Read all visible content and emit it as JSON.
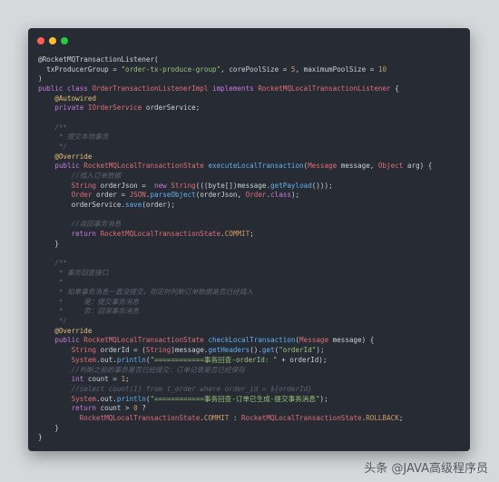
{
  "window": {
    "traffic_lights": [
      {
        "name": "close",
        "color": "#ff5f56"
      },
      {
        "name": "minimize",
        "color": "#ffbd2e"
      },
      {
        "name": "zoom",
        "color": "#27c93f"
      }
    ]
  },
  "colors": {
    "plain": "#c9d1d9",
    "keyword": "#c678dd",
    "annotation": "#e5c07b",
    "string": "#98c379",
    "comment": "#5c6370",
    "type": "#e06c75",
    "method": "#61afef",
    "number": "#d19a66"
  },
  "code_lines": [
    [
      [
        "p",
        "@RocketMQTransactionListener("
      ]
    ],
    [
      [
        "p",
        "  txProducerGroup = "
      ],
      [
        "s",
        "\"order-tx-produce-group\""
      ],
      [
        "p",
        ", corePoolSize = "
      ],
      [
        "n",
        "5"
      ],
      [
        "p",
        ", maximumPoolSize = "
      ],
      [
        "n",
        "10"
      ]
    ],
    [
      [
        "p",
        ")"
      ]
    ],
    [
      [
        "k",
        "public class "
      ],
      [
        "t",
        "OrderTransactionListenerImpl"
      ],
      [
        "k",
        " implements "
      ],
      [
        "t",
        "RocketMQLocalTransactionListener"
      ],
      [
        "p",
        " {"
      ]
    ],
    [
      [
        "a",
        "    @Autowired"
      ]
    ],
    [
      [
        "k",
        "    private "
      ],
      [
        "t",
        "IOrderService"
      ],
      [
        "p",
        " orderService;"
      ]
    ],
    [
      [
        "p",
        ""
      ]
    ],
    [
      [
        "c",
        "    /**"
      ]
    ],
    [
      [
        "c",
        "     * 提交本地事务"
      ]
    ],
    [
      [
        "c",
        "     */"
      ]
    ],
    [
      [
        "a",
        "    @Override"
      ]
    ],
    [
      [
        "k",
        "    public "
      ],
      [
        "t",
        "RocketMQLocalTransactionState "
      ],
      [
        "m",
        "executeLocalTransaction"
      ],
      [
        "p",
        "("
      ],
      [
        "t",
        "Message"
      ],
      [
        "p",
        " message, "
      ],
      [
        "t",
        "Object"
      ],
      [
        "p",
        " arg) {"
      ]
    ],
    [
      [
        "c",
        "        //插入订单数据"
      ]
    ],
    [
      [
        "t",
        "        String"
      ],
      [
        "p",
        " orderJson =  "
      ],
      [
        "k",
        "new "
      ],
      [
        "t",
        "String"
      ],
      [
        "p",
        "(((byte[])message."
      ],
      [
        "m",
        "getPayload"
      ],
      [
        "p",
        "()));"
      ]
    ],
    [
      [
        "t",
        "        Order"
      ],
      [
        "p",
        " order = "
      ],
      [
        "t",
        "JSON"
      ],
      [
        "p",
        "."
      ],
      [
        "m",
        "parseObject"
      ],
      [
        "p",
        "(orderJson, "
      ],
      [
        "t",
        "Order"
      ],
      [
        "p",
        "."
      ],
      [
        "k",
        "class"
      ],
      [
        "p",
        ");"
      ]
    ],
    [
      [
        "p",
        "        orderService."
      ],
      [
        "m",
        "save"
      ],
      [
        "p",
        "(order);"
      ]
    ],
    [
      [
        "p",
        ""
      ]
    ],
    [
      [
        "c",
        "        //返回事务消息"
      ]
    ],
    [
      [
        "k",
        "        return "
      ],
      [
        "t",
        "RocketMQLocalTransactionState"
      ],
      [
        "p",
        "."
      ],
      [
        "n",
        "COMMIT"
      ],
      [
        "p",
        ";"
      ]
    ],
    [
      [
        "p",
        "    }"
      ]
    ],
    [
      [
        "p",
        ""
      ]
    ],
    [
      [
        "c",
        "    /**"
      ]
    ],
    [
      [
        "c",
        "     * 事务回查接口"
      ]
    ],
    [
      [
        "c",
        "     *"
      ]
    ],
    [
      [
        "c",
        "     * 如果事务消息一直没提交，则定时判断订单数据是否已经插入"
      ]
    ],
    [
      [
        "c",
        "     *     是：提交事务消息"
      ]
    ],
    [
      [
        "c",
        "     *     否：回滚事务消息"
      ]
    ],
    [
      [
        "c",
        "     */"
      ]
    ],
    [
      [
        "a",
        "    @Override"
      ]
    ],
    [
      [
        "k",
        "    public "
      ],
      [
        "t",
        "RocketMQLocalTransactionState "
      ],
      [
        "m",
        "checkLocalTransaction"
      ],
      [
        "p",
        "("
      ],
      [
        "t",
        "Message"
      ],
      [
        "p",
        " message) {"
      ]
    ],
    [
      [
        "t",
        "        String"
      ],
      [
        "p",
        " orderId = ("
      ],
      [
        "t",
        "String"
      ],
      [
        "p",
        ")message."
      ],
      [
        "m",
        "getHeaders"
      ],
      [
        "p",
        "()."
      ],
      [
        "m",
        "get"
      ],
      [
        "p",
        "("
      ],
      [
        "s",
        "\"orderId\""
      ],
      [
        "p",
        ");"
      ]
    ],
    [
      [
        "t",
        "        System"
      ],
      [
        "p",
        ".out."
      ],
      [
        "m",
        "println"
      ],
      [
        "p",
        "("
      ],
      [
        "s",
        "\"============事务回查-orderId: \""
      ],
      [
        "p",
        " + orderId);"
      ]
    ],
    [
      [
        "c",
        "        //判断之前的事务是否已经提交：订单记录是否已经保存"
      ]
    ],
    [
      [
        "k",
        "        int"
      ],
      [
        "p",
        " count = "
      ],
      [
        "n",
        "1"
      ],
      [
        "p",
        ";"
      ]
    ],
    [
      [
        "c",
        "        //select count(1) from t_order where order_id = ${orderId}"
      ]
    ],
    [
      [
        "t",
        "        System"
      ],
      [
        "p",
        ".out."
      ],
      [
        "m",
        "println"
      ],
      [
        "p",
        "("
      ],
      [
        "s",
        "\"============事务回查-订单已生成-提交事务消息\""
      ],
      [
        "p",
        ");"
      ]
    ],
    [
      [
        "k",
        "        return"
      ],
      [
        "p",
        " count > "
      ],
      [
        "n",
        "0"
      ],
      [
        "p",
        " ?"
      ]
    ],
    [
      [
        "t",
        "          RocketMQLocalTransactionState"
      ],
      [
        "p",
        "."
      ],
      [
        "n",
        "COMMIT"
      ],
      [
        "p",
        " : "
      ],
      [
        "t",
        "RocketMQLocalTransactionState"
      ],
      [
        "p",
        "."
      ],
      [
        "n",
        "ROLLBACK"
      ],
      [
        "p",
        ";"
      ]
    ],
    [
      [
        "p",
        "    }"
      ]
    ],
    [
      [
        "p",
        "}"
      ]
    ]
  ],
  "watermark": "头条 @JAVA高级程序员"
}
